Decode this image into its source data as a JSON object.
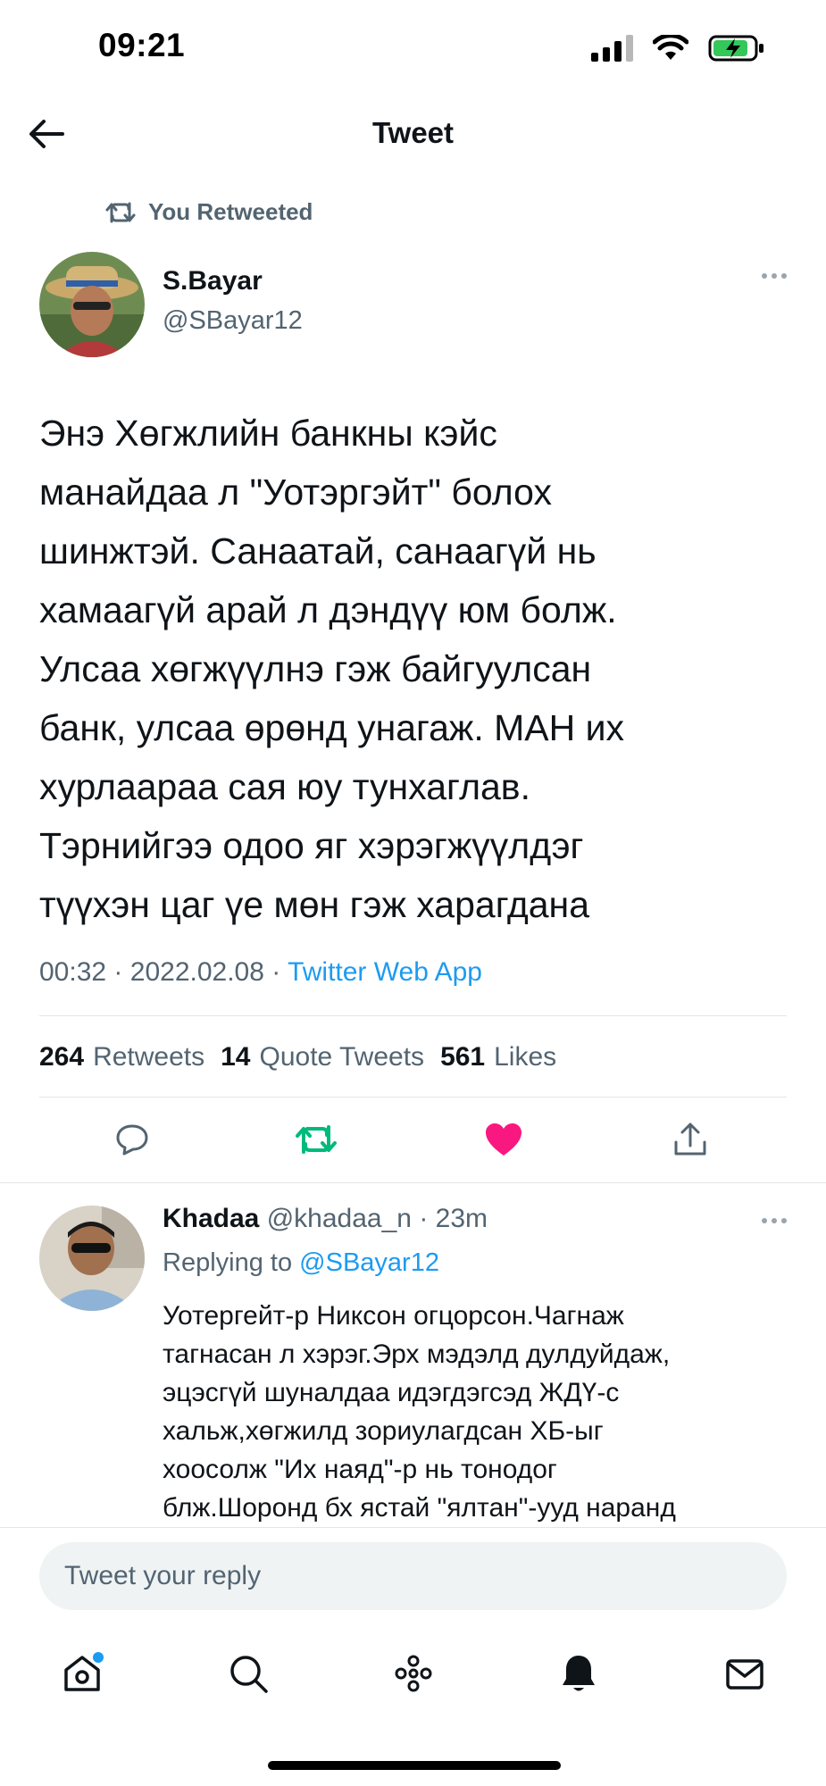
{
  "status_bar": {
    "time": "09:21"
  },
  "header": {
    "title": "Tweet",
    "back_icon": "arrow-left-icon"
  },
  "retweet_context": {
    "label": "You Retweeted",
    "icon": "retweet-icon"
  },
  "tweet": {
    "author_name": "S.Bayar",
    "author_handle": "@SBayar12",
    "text_lines": [
      "Энэ Хөгжлийн банкны кэйс",
      "манайдаа л \"Уотэргэйт\" болох",
      "шинжтэй. Санаатай, санаагүй нь",
      "хамаагүй арай л дэндүү юм болж.",
      "Улсаа хөгжүүлнэ гэж байгуулсан",
      "банк, улсаа өрөнд унагаж. МАН их",
      "хурлаараа сая юу тунхаглав.",
      "Тэрнийгээ одоо яг хэрэгжүүлдэг",
      "түүхэн цаг үе мөн гэж харагдана"
    ],
    "time": "00:32",
    "date": "2022.02.08",
    "separator": "·",
    "source": "Twitter Web App",
    "stats": {
      "retweets_count": "264",
      "retweets_label": "Retweets",
      "quotes_count": "14",
      "quotes_label": "Quote Tweets",
      "likes_count": "561",
      "likes_label": "Likes"
    },
    "liked": true,
    "retweeted": true
  },
  "reply": {
    "author_name": "Khadaa",
    "author_handle": "@khadaa_n",
    "separator": "·",
    "age": "23m",
    "replying_prefix": "Replying to",
    "replying_to": "@SBayar12",
    "text_lines": [
      "Уотергейт-р Никсон огцорсон.Чагнаж",
      "тагнасан л хэрэг.Эрх мэдэлд дулдуйдаж,",
      "эцэсгүй шуналдаа идэгдэгсэд  ЖДҮ-с",
      "хальж,хөгжилд зориулагдсан ХБ-ыг",
      "хоосолж \"Их наяд\"-р нь тонодог",
      "блж.Шоронд бх ястай \"ялтан\"-ууд наранд"
    ]
  },
  "composer": {
    "placeholder": "Tweet your reply"
  },
  "colors": {
    "accent": "#1d9bf0",
    "retweet": "#00ba7c",
    "like": "#f91880",
    "muted": "#536471"
  }
}
